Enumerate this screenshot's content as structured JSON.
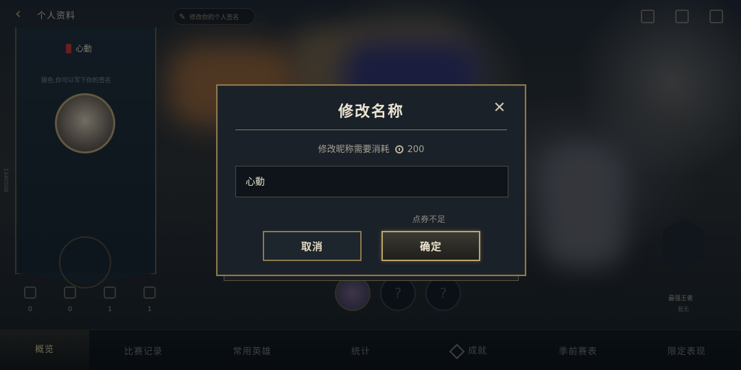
{
  "header": {
    "back_icon": "back-arrow-icon",
    "title": "个人资料",
    "pill_text": "修改你的个人签名",
    "right_icons": [
      "rank-icon",
      "share-icon",
      "settings-icon"
    ]
  },
  "profile": {
    "name": "心動",
    "sub": "银色,你可以写下你的签名",
    "uid": "1340508"
  },
  "stats": [
    {
      "icon": "trophy-icon",
      "value": "0"
    },
    {
      "icon": "medal-icon",
      "value": "0"
    },
    {
      "icon": "star-icon",
      "value": "1"
    },
    {
      "icon": "chart-icon",
      "value": "1"
    }
  ],
  "right_panel": {
    "label": "最强王者",
    "sub": "暂无"
  },
  "bottom_nav": [
    "概览",
    "比赛记录",
    "常用英雄",
    "统计",
    "成就",
    "季前赛表",
    "限定表现"
  ],
  "dialog": {
    "title": "修改名称",
    "close_icon": "close-icon",
    "cost_text": "修改昵称需要消耗",
    "cost_icon": "coupon-icon",
    "cost_value": "200",
    "input_value": "心動",
    "warning": "点券不足",
    "cancel_label": "取消",
    "confirm_label": "确定"
  },
  "colors": {
    "accent_gold": "#8e7a4f",
    "dialog_bg": "#1a2129"
  }
}
